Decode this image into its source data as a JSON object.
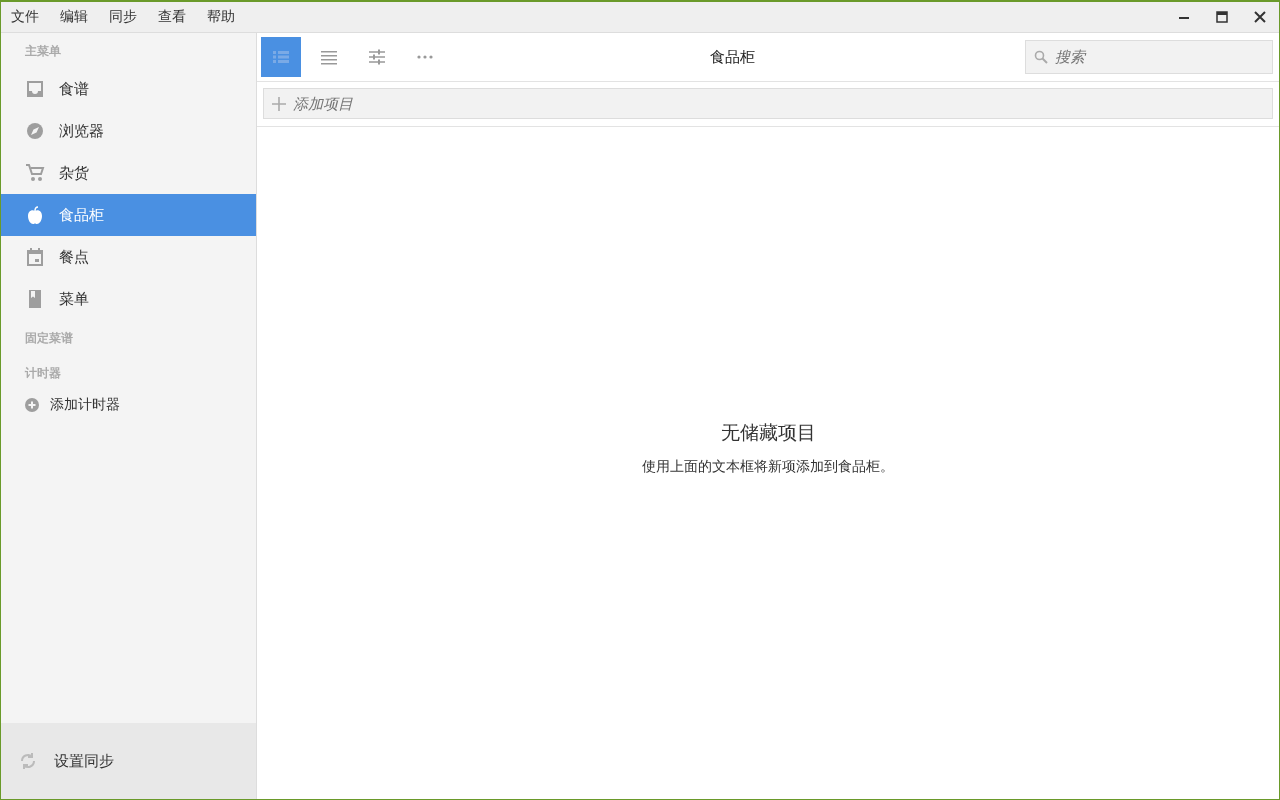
{
  "menu": [
    "文件",
    "编辑",
    "同步",
    "查看",
    "帮助"
  ],
  "sidebar": {
    "main_heading": "主菜单",
    "items": [
      {
        "label": "食谱",
        "kind": "inbox",
        "selected": false
      },
      {
        "label": "浏览器",
        "kind": "compass",
        "selected": false
      },
      {
        "label": "杂货",
        "kind": "cart",
        "selected": false
      },
      {
        "label": "食品柜",
        "kind": "apple",
        "selected": true
      },
      {
        "label": "餐点",
        "kind": "calendar",
        "selected": false
      },
      {
        "label": "菜单",
        "kind": "book",
        "selected": false
      }
    ],
    "pinned_heading": "固定菜谱",
    "timers_heading": "计时器",
    "add_timer": "添加计时器",
    "sync": "设置同步"
  },
  "toolbar": {
    "views": [
      {
        "kind": "detailed",
        "selected": true
      },
      {
        "kind": "list",
        "selected": false
      },
      {
        "kind": "sliders",
        "selected": false
      },
      {
        "kind": "more",
        "selected": false
      }
    ],
    "title": "食品柜",
    "search": {
      "placeholder": "搜索"
    }
  },
  "add_item": {
    "placeholder": "添加项目"
  },
  "empty": {
    "title": "无储藏项目",
    "message": "使用上面的文本框将新项添加到食品柜。"
  }
}
